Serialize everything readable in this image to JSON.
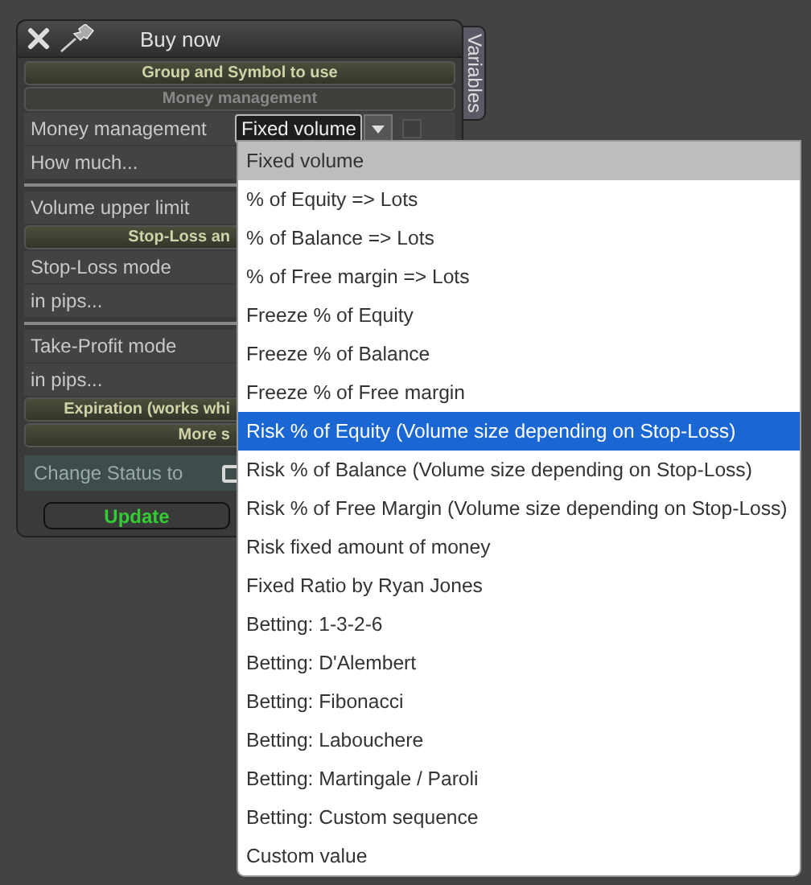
{
  "window": {
    "title": "Buy now",
    "side_tab": "Variables"
  },
  "sections": [
    {
      "kind": "header",
      "text": "Group and Symbol to use"
    },
    {
      "kind": "subheader",
      "text": "Money management"
    },
    {
      "kind": "dropdown",
      "label": "Money management",
      "value": "Fixed volume",
      "expanded": true,
      "checked": false
    },
    {
      "kind": "row",
      "label": "How much..."
    },
    {
      "kind": "divider"
    },
    {
      "kind": "row",
      "label": "Volume upper limit"
    },
    {
      "kind": "header",
      "text": "Stop-Loss an"
    },
    {
      "kind": "row",
      "label": "Stop-Loss mode"
    },
    {
      "kind": "row",
      "label": "in pips..."
    },
    {
      "kind": "divider"
    },
    {
      "kind": "row",
      "label": "Take-Profit mode"
    },
    {
      "kind": "row",
      "label": "in pips..."
    },
    {
      "kind": "header",
      "text": "Expiration (works whi"
    },
    {
      "kind": "header",
      "text": "More s"
    },
    {
      "kind": "check",
      "label": "Change Status to",
      "checked": false
    },
    {
      "kind": "button",
      "text": "Update"
    }
  ],
  "menu": [
    {
      "label": "Fixed volume",
      "selected": true,
      "highlighted": false
    },
    {
      "label": "% of Equity => Lots",
      "selected": false,
      "highlighted": false
    },
    {
      "label": "% of Balance => Lots",
      "selected": false,
      "highlighted": false
    },
    {
      "label": "% of Free margin => Lots",
      "selected": false,
      "highlighted": false
    },
    {
      "label": "Freeze % of Equity",
      "selected": false,
      "highlighted": false
    },
    {
      "label": "Freeze % of Balance",
      "selected": false,
      "highlighted": false
    },
    {
      "label": "Freeze % of Free margin",
      "selected": false,
      "highlighted": false
    },
    {
      "label": "Risk % of Equity (Volume size depending on Stop-Loss)",
      "selected": false,
      "highlighted": true
    },
    {
      "label": "Risk % of Balance (Volume size depending on Stop-Loss)",
      "selected": false,
      "highlighted": false
    },
    {
      "label": "Risk % of Free Margin (Volume size depending on Stop-Loss)",
      "selected": false,
      "highlighted": false
    },
    {
      "label": "Risk fixed amount of money",
      "selected": false,
      "highlighted": false
    },
    {
      "label": "Fixed Ratio by Ryan Jones",
      "selected": false,
      "highlighted": false
    },
    {
      "label": "Betting: 1-3-2-6",
      "selected": false,
      "highlighted": false
    },
    {
      "label": "Betting: D'Alembert",
      "selected": false,
      "highlighted": false
    },
    {
      "label": "Betting: Fibonacci",
      "selected": false,
      "highlighted": false
    },
    {
      "label": "Betting: Labouchere",
      "selected": false,
      "highlighted": false
    },
    {
      "label": "Betting: Martingale / Paroli",
      "selected": false,
      "highlighted": false
    },
    {
      "label": "Betting: Custom sequence",
      "selected": false,
      "highlighted": false
    },
    {
      "label": "Custom value",
      "selected": false,
      "highlighted": false
    }
  ]
}
